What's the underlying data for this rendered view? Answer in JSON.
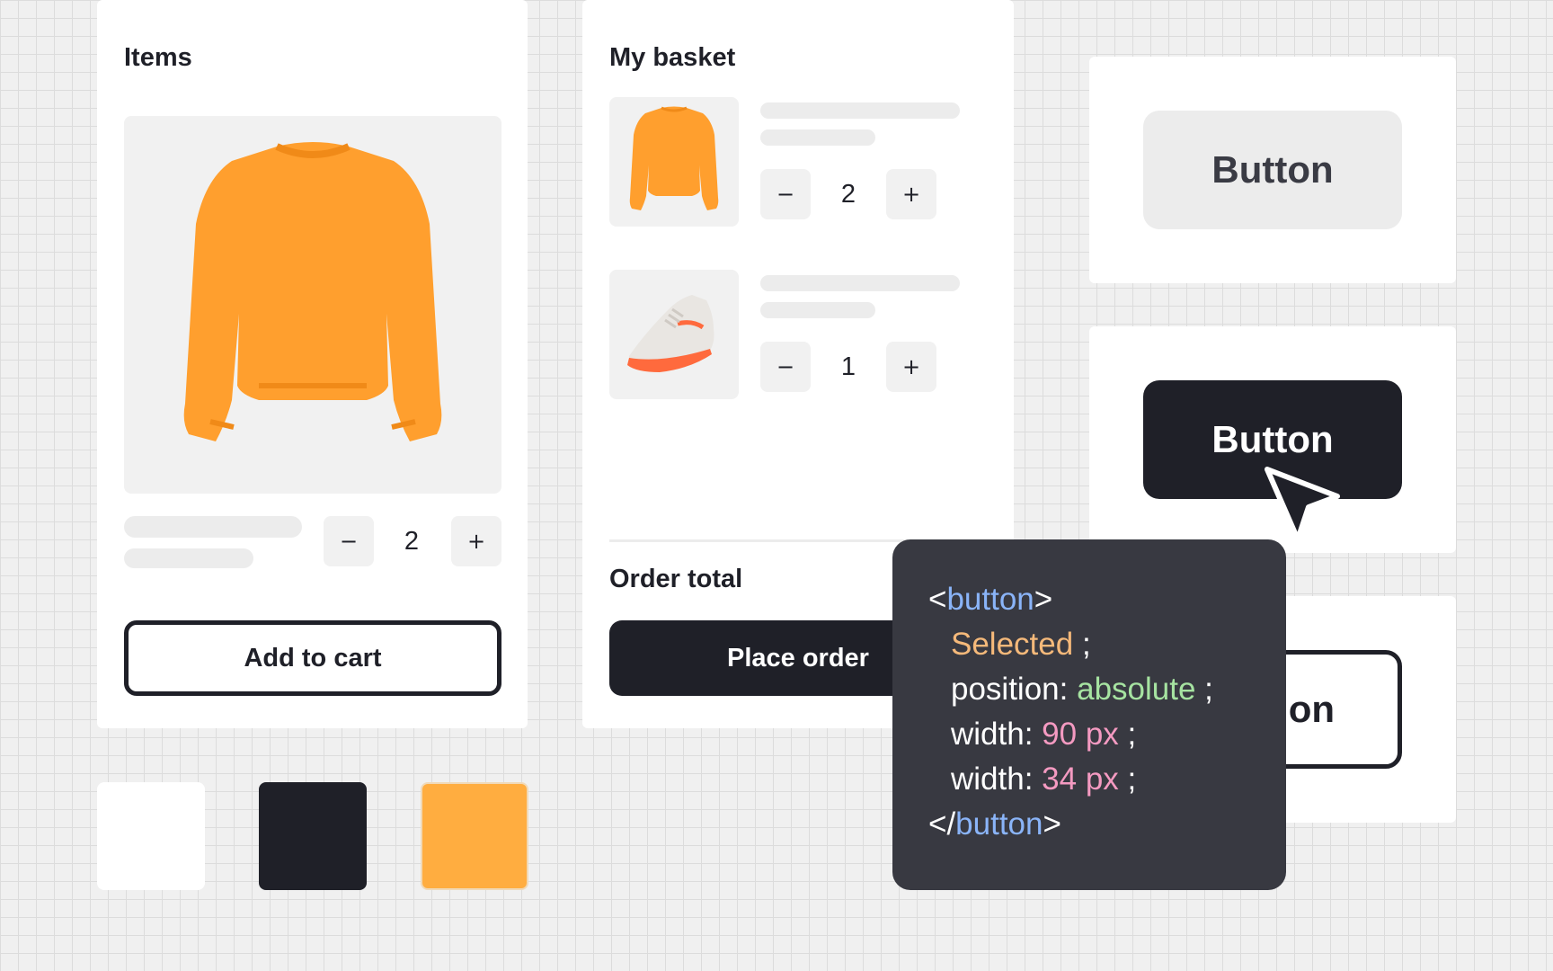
{
  "colors": {
    "dark": "#1f2028",
    "orange": "#ffad40",
    "white": "#ffffff",
    "code_bg": "#383941",
    "code_tag": "#8ab4f8",
    "code_selector": "#f5b97a",
    "code_value_green": "#a6e3a1",
    "code_value_pink": "#f49ac1"
  },
  "items_card": {
    "title": "Items",
    "product_image": "orange-sweatshirt-image",
    "stepper": {
      "minus": "−",
      "value": "2",
      "plus": "+"
    },
    "add_to_cart_label": "Add to cart"
  },
  "basket_card": {
    "title": "My basket",
    "items": [
      {
        "image": "orange-sweatshirt-thumbnail",
        "quantity": "2",
        "minus": "−",
        "plus": "+"
      },
      {
        "image": "sneaker-thumbnail",
        "quantity": "1",
        "minus": "−",
        "plus": "+"
      }
    ],
    "order_total_label": "Order total",
    "place_order_label": "Place order"
  },
  "button_states": {
    "default_label": "Button",
    "hover_label": "Button",
    "outline_visible_label": "on"
  },
  "cursor": "cursor-arrow-icon",
  "swatches": [
    "#ffffff",
    "#1f2028",
    "#ffad40"
  ],
  "code": {
    "tag_open_bracket": "<",
    "tag_name": "button",
    "tag_close_bracket": ">",
    "selected_keyword": "Selected",
    "semicolon": ";",
    "position_prop": "position:",
    "position_value": "absolute",
    "width_prop": "width:",
    "width_value_1": "90",
    "width_value_2": "34",
    "unit": "px",
    "close_tag_open": "</"
  }
}
